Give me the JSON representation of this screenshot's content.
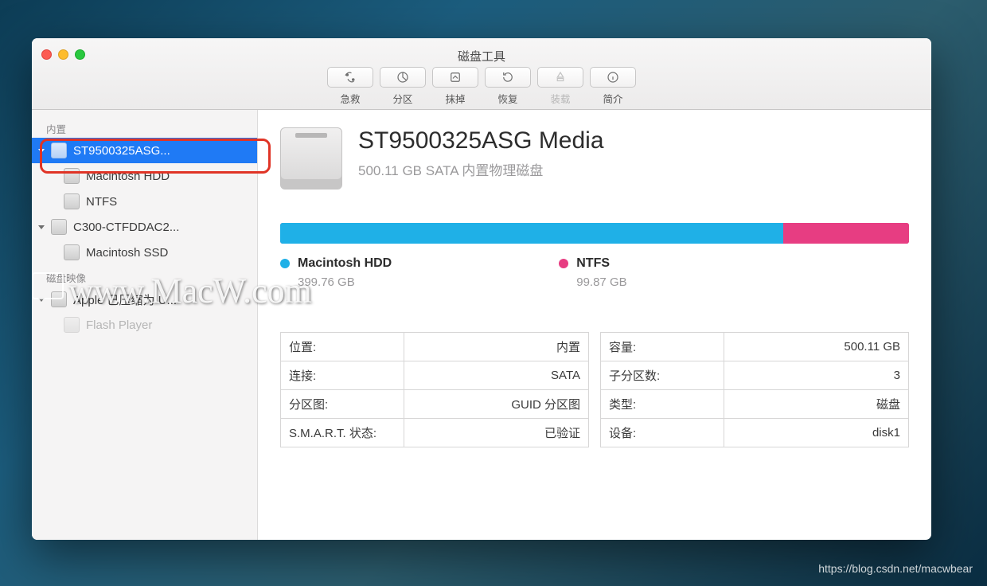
{
  "watermark": "www.MacW.com",
  "source_url": "https://blog.csdn.net/macwbear",
  "window": {
    "title": "磁盘工具",
    "toolbar": [
      {
        "name": "first-aid",
        "label": "急救",
        "disabled": false
      },
      {
        "name": "partition",
        "label": "分区",
        "disabled": false
      },
      {
        "name": "erase",
        "label": "抹掉",
        "disabled": false
      },
      {
        "name": "restore",
        "label": "恢复",
        "disabled": false
      },
      {
        "name": "mount",
        "label": "装载",
        "disabled": true
      },
      {
        "name": "info",
        "label": "简介",
        "disabled": false
      }
    ]
  },
  "sidebar": {
    "sections": [
      {
        "label": "内置",
        "items": [
          {
            "label": "ST9500325ASG...",
            "selected": true,
            "expandable": true,
            "children": [
              {
                "label": "Macintosh HDD"
              },
              {
                "label": "NTFS"
              }
            ]
          },
          {
            "label": "C300-CTFDDAC2...",
            "expandable": true,
            "children": [
              {
                "label": "Macintosh SSD"
              }
            ]
          }
        ]
      },
      {
        "label": "磁盘映像",
        "items": [
          {
            "label": "Apple 已压缩为 U...",
            "expandable": true,
            "children": [
              {
                "label": "Flash Player",
                "dim": true
              }
            ]
          }
        ]
      }
    ]
  },
  "main": {
    "title": "ST9500325ASG Media",
    "subtitle": "500.11 GB SATA 内置物理磁盘",
    "partitions": [
      {
        "name": "Macintosh HDD",
        "size": "399.76 GB",
        "color": "#1fb0e7",
        "fraction": 0.8
      },
      {
        "name": "NTFS",
        "size": "99.87 GB",
        "color": "#e73d82",
        "fraction": 0.2
      }
    ],
    "details_left": [
      {
        "k": "位置:",
        "v": "内置"
      },
      {
        "k": "连接:",
        "v": "SATA"
      },
      {
        "k": "分区图:",
        "v": "GUID 分区图"
      },
      {
        "k": "S.M.A.R.T. 状态:",
        "v": "已验证"
      }
    ],
    "details_right": [
      {
        "k": "容量:",
        "v": "500.11 GB"
      },
      {
        "k": "子分区数:",
        "v": "3"
      },
      {
        "k": "类型:",
        "v": "磁盘"
      },
      {
        "k": "设备:",
        "v": "disk1"
      }
    ]
  }
}
